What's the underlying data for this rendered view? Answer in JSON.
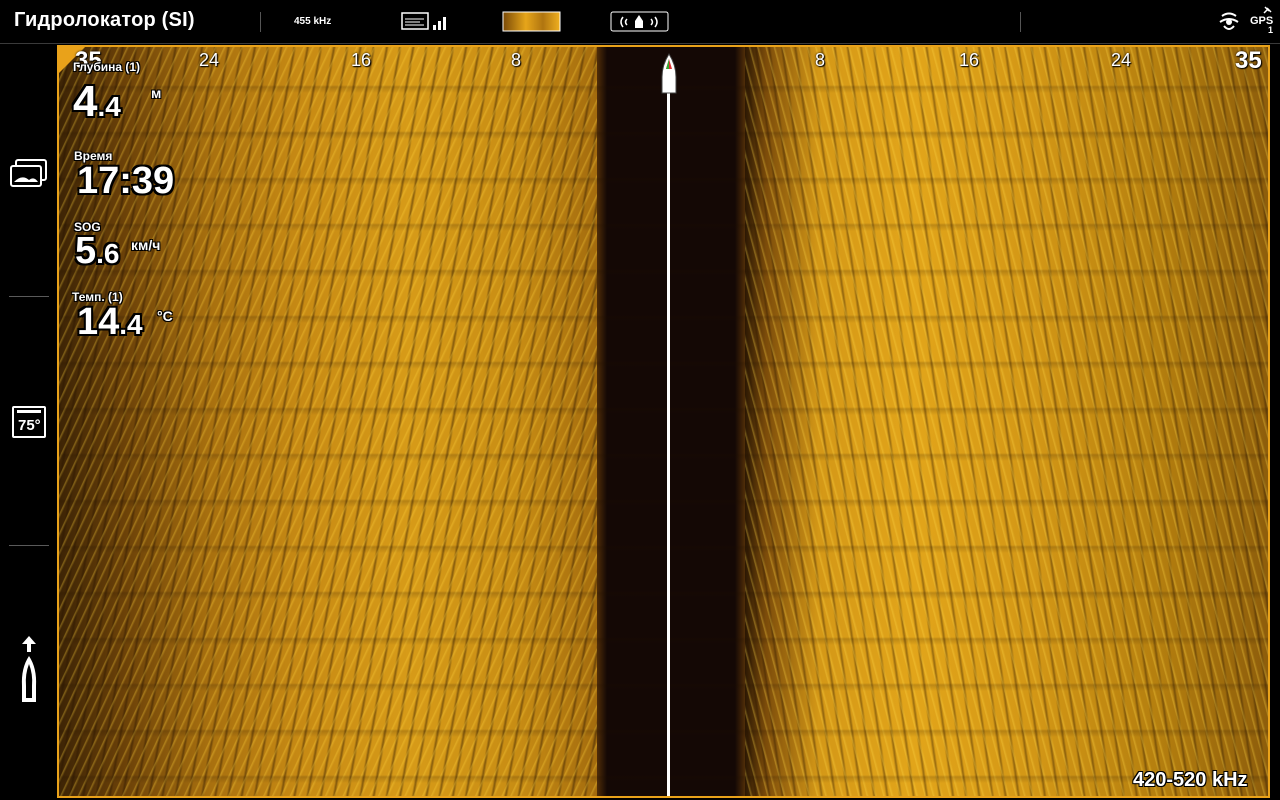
{
  "header": {
    "title": "Гидролокатор (SI)",
    "frequency": "455 kHz",
    "icons": [
      "chart-signal-icon",
      "sonar-palette-icon",
      "transducer-icon",
      "sonar-mode-icon"
    ],
    "gps_label": "GPS",
    "gps_count": "1"
  },
  "sidebar": {
    "icons": [
      "cards-icon",
      "temperature-75-icon",
      "boat-direction-icon"
    ],
    "temp_badge": "75°"
  },
  "sonar": {
    "range_left": [
      "35",
      "24",
      "16",
      "8"
    ],
    "range_right": [
      "8",
      "16",
      "24",
      "35"
    ],
    "frequency": "420-520 kHz",
    "colors": {
      "border": "#e9a21a",
      "water_column": "#140805",
      "return_light": "#e2a51a",
      "return_dark": "#3d2405"
    }
  },
  "overlays": {
    "depth": {
      "label": "Глубина (1)",
      "int": "4",
      "dec": ".4",
      "unit": "м"
    },
    "time": {
      "label": "Время",
      "value": "17:39"
    },
    "sog": {
      "label": "SOG",
      "int": "5",
      "dec": ".6",
      "unit": "км/ч"
    },
    "temp": {
      "label": "Темп. (1)",
      "int": "14",
      "dec": ".4",
      "unit": "°C"
    }
  }
}
